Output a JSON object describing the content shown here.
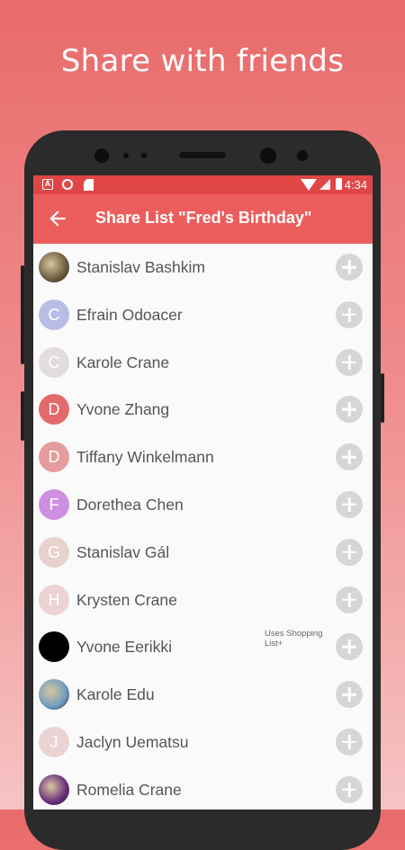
{
  "headline": "Share with friends",
  "status_bar": {
    "time": "4:34",
    "notification_a": "A"
  },
  "app_bar": {
    "title": "Share List \"Fred's Birthday\""
  },
  "colors": {
    "status_bar": "#e04646",
    "app_bar": "#ec5e5e",
    "add_button": "#d6d6d6"
  },
  "contacts": [
    {
      "name": "Stanislav Bashkim",
      "initial": "",
      "avatar_color": "#6b5a3e",
      "avatar_type": "photo"
    },
    {
      "name": "Efrain Odoacer",
      "initial": "C",
      "avatar_color": "#b8bde6",
      "avatar_type": "letter"
    },
    {
      "name": "Karole Crane",
      "initial": "C",
      "avatar_color": "#e3dcdc",
      "avatar_type": "letter"
    },
    {
      "name": "Yvone Zhang",
      "initial": "D",
      "avatar_color": "#e36a6a",
      "avatar_type": "letter"
    },
    {
      "name": "Tiffany Winkelmann",
      "initial": "D",
      "avatar_color": "#e59c9c",
      "avatar_type": "letter"
    },
    {
      "name": "Dorethea Chen",
      "initial": "F",
      "avatar_color": "#cf8fe0",
      "avatar_type": "letter"
    },
    {
      "name": "Stanislav Gál",
      "initial": "G",
      "avatar_color": "#e8d2ce",
      "avatar_type": "letter"
    },
    {
      "name": "Krysten Crane",
      "initial": "H",
      "avatar_color": "#ebd3d3",
      "avatar_type": "letter"
    },
    {
      "name": "Yvone Eerikki",
      "initial": "",
      "avatar_color": "#000000",
      "avatar_type": "photo",
      "note": "Uses Shopping List+"
    },
    {
      "name": "Karole Edu",
      "initial": "",
      "avatar_color": "#6f9bbf",
      "avatar_type": "photo"
    },
    {
      "name": "Jaclyn Uematsu",
      "initial": "J",
      "avatar_color": "#ecd3d3",
      "avatar_type": "letter"
    },
    {
      "name": "Romelia Crane",
      "initial": "",
      "avatar_color": "#6a2c7a",
      "avatar_type": "photo"
    }
  ]
}
